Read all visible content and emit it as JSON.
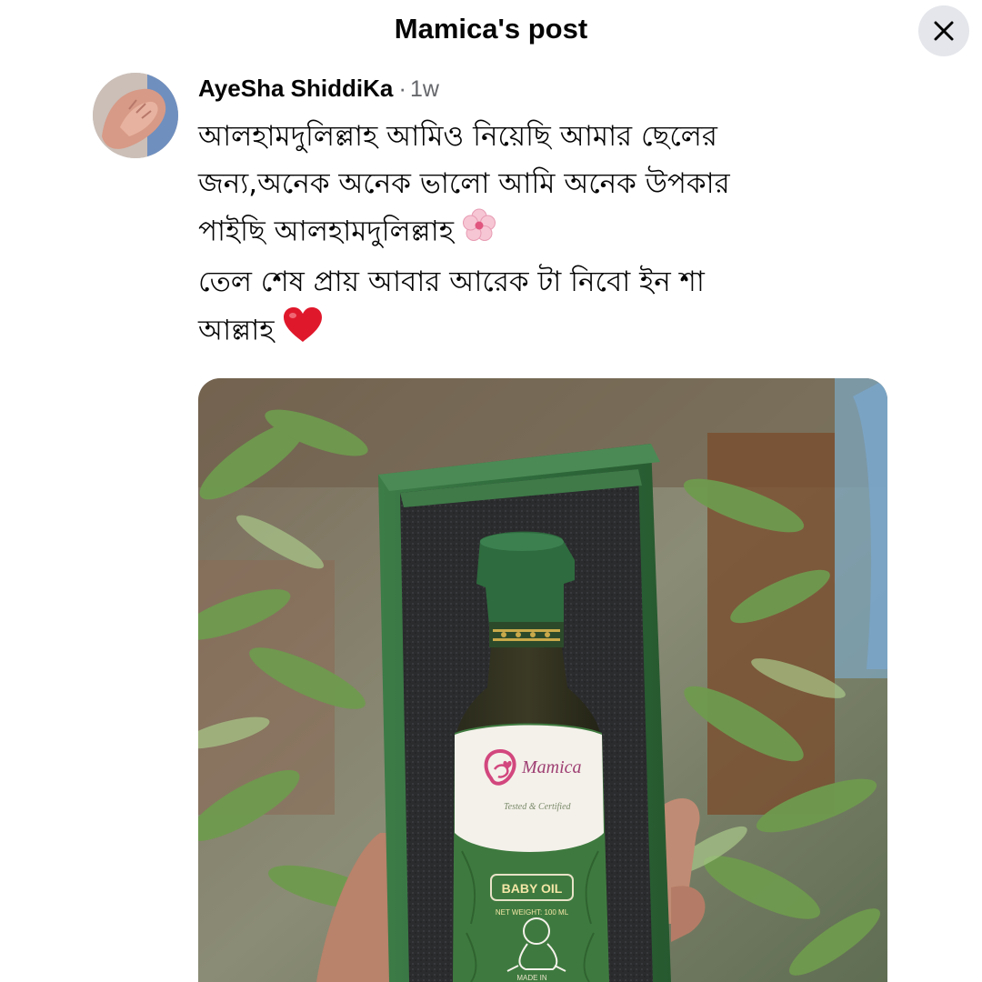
{
  "header": {
    "title": "Mamica's post"
  },
  "comment": {
    "author": "AyeSha ShiddiKa",
    "separator": "·",
    "time": "1w",
    "lines": [
      "আলহামদুলিল্লাহ আমিও নিয়েছি  আমার ছেলের",
      "জন্য,অনেক অনেক ভালো আমি অনেক উপকার",
      "পাইছি আলহামদুলিল্লাহ",
      "তেল শেষ প্রায় আবার আরেক টা নিবো ইন শা",
      "আল্লাহ"
    ]
  },
  "photo": {
    "brand": "Mamica",
    "tagline": "Tested & Certified",
    "product": "BABY OIL",
    "net_weight": "NET WEIGHT: 100 ML",
    "bottom_label": "MADE IN"
  },
  "icons": {
    "close": "close-icon",
    "flower": "cherry-blossom-emoji",
    "heart": "red-heart-emoji"
  },
  "colors": {
    "header_button_bg": "#e4e6eb",
    "meta_text": "#65676b",
    "box_green": "#2f6b3c",
    "label_pink": "#d2477e"
  }
}
